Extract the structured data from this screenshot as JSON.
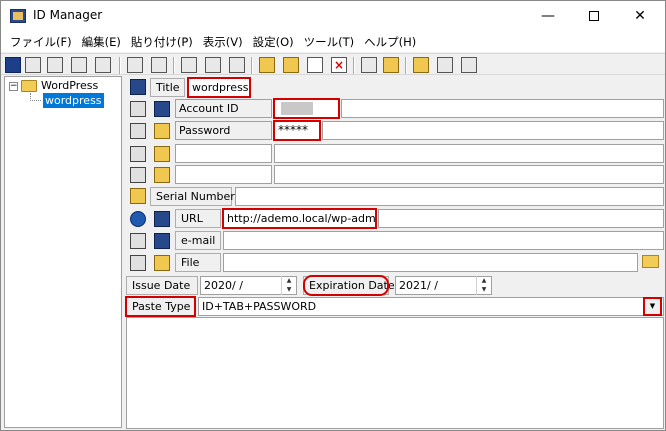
{
  "window": {
    "title": "ID Manager"
  },
  "window_controls": {
    "minimize": "—",
    "maximize": "",
    "close": "✕"
  },
  "menu": [
    "ファイル(F)",
    "編集(E)",
    "貼り付け(P)",
    "表示(V)",
    "設定(O)",
    "ツール(T)",
    "ヘルプ(H)"
  ],
  "toolbar": {
    "icons": [
      "ftp",
      "html",
      "acc",
      "pass",
      "file",
      "note",
      "page",
      "idp"
    ]
  },
  "tree": {
    "root_expander": "−",
    "root": "WordPress",
    "selected": "wordpress"
  },
  "form": {
    "title_label": "Title",
    "title_value": "wordpress",
    "account_label": "Account ID",
    "account_value": "",
    "password_label": "Password",
    "password_value": "*****",
    "extra1_label": "",
    "extra1_value": "",
    "extra2_label": "",
    "extra2_value": "",
    "serial_label": "Serial Number",
    "serial_value": "",
    "url_label": "URL",
    "url_value": "http://ademo.local/wp-admin",
    "email_label": "e-mail",
    "email_value": "",
    "file_label": "File",
    "file_value": "",
    "issue_label": "Issue Date",
    "issue_value": "2020/   /",
    "expiration_label": "Expiration Date",
    "expiration_value": "2021/   /",
    "paste_label": "Paste Type",
    "paste_value": "ID+TAB+PASSWORD",
    "memo": ""
  },
  "colors": {
    "highlight": "#d40000",
    "selection": "#0078d7"
  }
}
